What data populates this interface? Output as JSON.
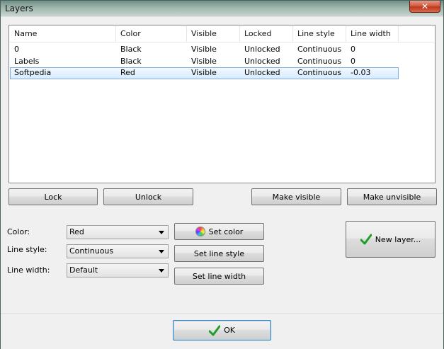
{
  "window": {
    "title": "Layers"
  },
  "list": {
    "columns": [
      "Name",
      "Color",
      "Visible",
      "Locked",
      "Line style",
      "Line width"
    ],
    "rows": [
      {
        "name": "0",
        "color": "Black",
        "visible": "Visible",
        "locked": "Unlocked",
        "line_style": "Continuous",
        "line_width": "0"
      },
      {
        "name": "Labels",
        "color": "Black",
        "visible": "Visible",
        "locked": "Unlocked",
        "line_style": "Continuous",
        "line_width": "0"
      },
      {
        "name": "Softpedia",
        "color": "Red",
        "visible": "Visible",
        "locked": "Unlocked",
        "line_style": "Continuous",
        "line_width": "-0.03"
      }
    ],
    "selected_row_index": 2
  },
  "buttons": {
    "lock": "Lock",
    "unlock": "Unlock",
    "make_visible": "Make visible",
    "make_unvisible": "Make unvisible",
    "set_color": "Set color",
    "set_line_style": "Set line style",
    "set_line_width": "Set line width",
    "new_layer": "New layer...",
    "ok": "OK"
  },
  "form": {
    "color_label": "Color:",
    "color_value": "Red",
    "line_style_label": "Line style:",
    "line_style_value": "Continuous",
    "line_width_label": "Line width:",
    "line_width_value": "Default"
  },
  "colors": {
    "selected_row_bg": "#d7ebff",
    "selected_row_border": "#84acdd",
    "check_green": "#1f9e2a"
  }
}
